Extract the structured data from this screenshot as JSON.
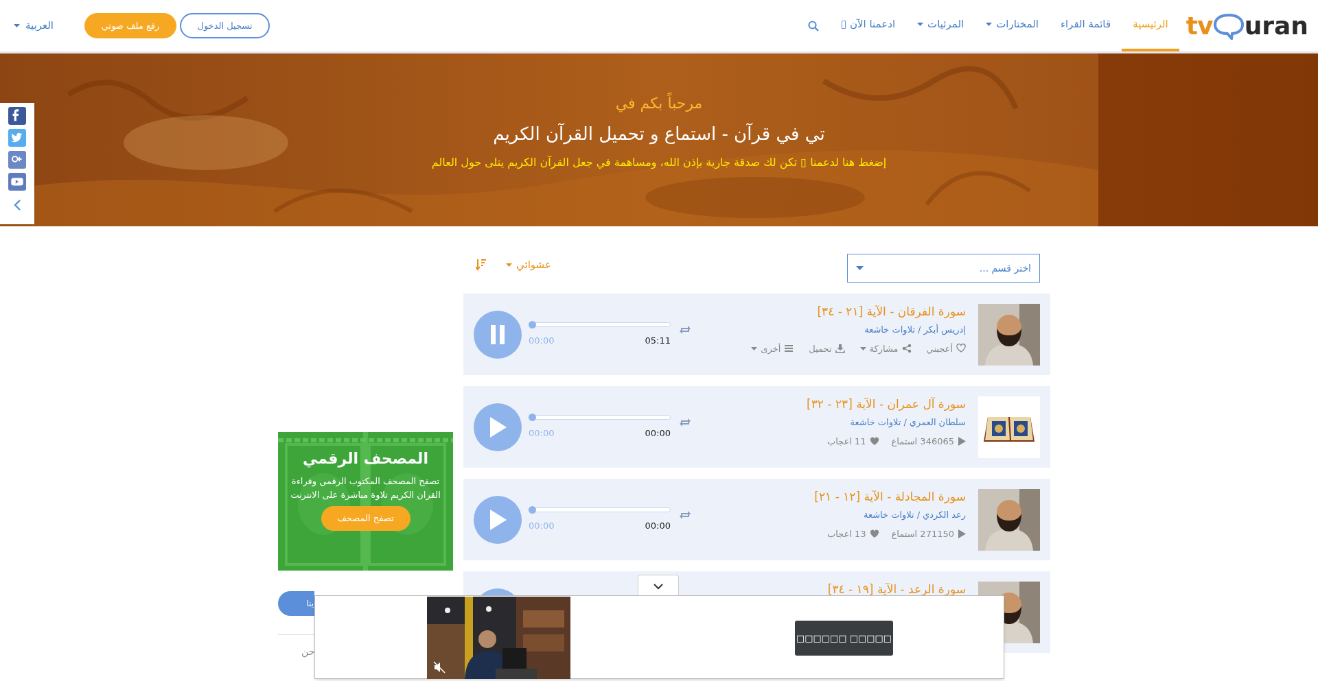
{
  "logo": {
    "prefix": "tv",
    "suffix": "uran"
  },
  "nav": [
    {
      "label": "الرئيسية",
      "selected": true,
      "dropdown": false
    },
    {
      "label": "قائمة القراء",
      "selected": false,
      "dropdown": false
    },
    {
      "label": "المختارات",
      "selected": false,
      "dropdown": true
    },
    {
      "label": "المرئيات",
      "selected": false,
      "dropdown": true
    },
    {
      "label": "ادعمنا الآن ▯",
      "selected": false,
      "dropdown": false
    }
  ],
  "login_button": "تسجيل الدخول",
  "upload_button": "رفع ملف صوتي",
  "language": "العربية",
  "hero": {
    "welcome": "مرحباً بكم في",
    "title": "تي في قرآن - استماع و تحميل القرآن الكريم",
    "support": "إضغط هنا لدعمنا ▯ تكن لك صدقة جارية بإذن الله، ومساهمة في جعل القرآن الكريم يتلى حول العالم"
  },
  "social": [
    {
      "kind": "facebook"
    },
    {
      "kind": "twitter"
    },
    {
      "kind": "googleplus"
    },
    {
      "kind": "youtube"
    }
  ],
  "filter": {
    "placeholder": "اختر قسم ...",
    "sort": "عشوائي"
  },
  "tracks": [
    {
      "kind": "actions",
      "title": "سورة الفرقان - الآية [٢١ - ٣٤]",
      "reader": "إدريس أبكر",
      "separator": "/",
      "category": "تلاوات خاشعة",
      "playing": true,
      "level": 0,
      "elapsed": "00:00",
      "duration": "05:11",
      "thumb": {
        "kind": "person"
      },
      "actions": [
        {
          "label": "أعجبني",
          "kind": "like",
          "dropdown": false
        },
        {
          "label": "مشاركة",
          "kind": "share",
          "dropdown": true
        },
        {
          "label": "تحميل",
          "kind": "download",
          "dropdown": false
        },
        {
          "label": "أخرى",
          "kind": "more",
          "dropdown": true
        }
      ]
    },
    {
      "kind": "stats",
      "title": "سورة آل عمران - الآية [٢٣ - ٣٢]",
      "reader": "سلطان العمري",
      "separator": "/",
      "category": "تلاوات خاشعة",
      "playing": false,
      "level": 0,
      "elapsed": "00:00",
      "duration": "00:00",
      "thumb": {
        "kind": "book"
      },
      "plays": "346065 استماع",
      "likes": "11 اعجاب"
    },
    {
      "kind": "stats",
      "title": "سورة المجادلة - الآية [١٢ - ٢١]",
      "reader": "رعد الكردي",
      "separator": "/",
      "category": "تلاوات خاشعة",
      "playing": false,
      "level": 0,
      "elapsed": "00:00",
      "duration": "00:00",
      "thumb": {
        "kind": "person"
      },
      "plays": "271150 استماع",
      "likes": "13 اعجاب"
    },
    {
      "kind": "partial",
      "title": "سورة الرعد - الآية [١٩ - ٣٤]",
      "thumb": {
        "kind": "person"
      }
    }
  ],
  "ad": {
    "title": "المصحف الرقمي",
    "text": "تصفح المصحف المكتوب الرقمي وقراءة القران الكريم تلاوة مباشرة على الانترنت",
    "button": "تصفح المصحف"
  },
  "side_button": "ينا",
  "side_text": "حن",
  "video_ad": {
    "button": "□□□□□□ □□□□□",
    "muted": true
  }
}
